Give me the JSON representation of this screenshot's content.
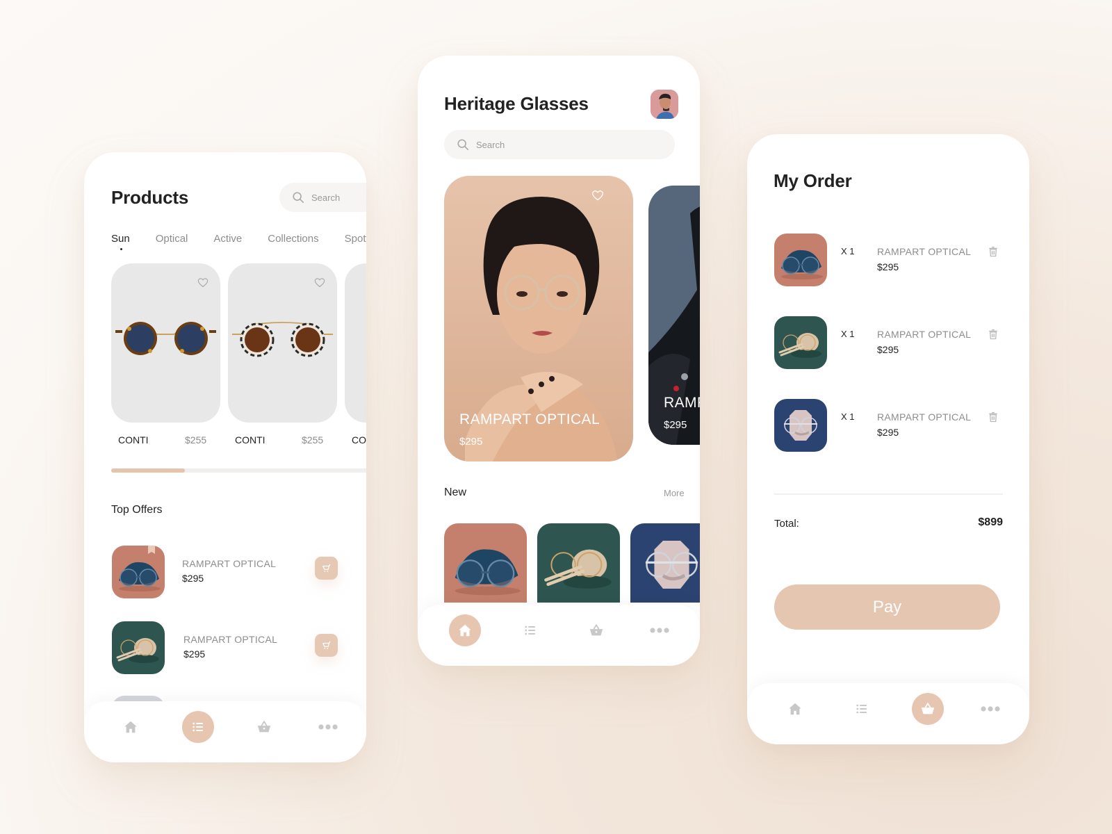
{
  "colors": {
    "accent": "#e4c6b1",
    "text_primary": "#222222",
    "text_secondary": "#8d8d8d",
    "icon_inactive": "#c8c8c8"
  },
  "products_screen": {
    "title": "Products",
    "search_placeholder": "Search",
    "tabs": [
      {
        "label": "Sun",
        "active": true
      },
      {
        "label": "Optical",
        "active": false
      },
      {
        "label": "Active",
        "active": false
      },
      {
        "label": "Collections",
        "active": false
      },
      {
        "label": "Spotti",
        "active": false
      }
    ],
    "products": [
      {
        "name": "CONTI",
        "price": "$255",
        "style": "tortoise-blue"
      },
      {
        "name": "CONTI",
        "price": "$255",
        "style": "marble-brown"
      },
      {
        "name": "CO",
        "price": "",
        "style": "partial"
      }
    ],
    "scroll_progress": 0.28,
    "top_offers_title": "Top Offers",
    "offers": [
      {
        "name": "RAMPART OPTICAL",
        "price": "$295",
        "thumb": "terracotta"
      },
      {
        "name": "RAMPART OPTICAL",
        "price": "$295",
        "thumb": "green"
      }
    ],
    "nav": [
      {
        "icon": "home-icon",
        "active": false
      },
      {
        "icon": "list-icon",
        "active": true
      },
      {
        "icon": "basket-icon",
        "active": false
      },
      {
        "icon": "more-icon",
        "active": false
      }
    ]
  },
  "home_screen": {
    "title": "Heritage Glasses",
    "search_placeholder": "Search",
    "featured": [
      {
        "name": "RAMPART OPTICAL",
        "price": "$295"
      },
      {
        "name": "RAMPART OPTICAL",
        "price": "$295"
      }
    ],
    "new_section_title": "New",
    "more_label": "More",
    "new_items": [
      "terracotta",
      "green",
      "navy"
    ],
    "nav": [
      {
        "icon": "home-icon",
        "active": true
      },
      {
        "icon": "list-icon",
        "active": false
      },
      {
        "icon": "basket-icon",
        "active": false
      },
      {
        "icon": "more-icon",
        "active": false
      }
    ]
  },
  "order_screen": {
    "title": "My Order",
    "items": [
      {
        "qty": "X 1",
        "name": "RAMPART OPTICAL",
        "price": "$295",
        "thumb": "terracotta"
      },
      {
        "qty": "X 1",
        "name": "RAMPART OPTICAL",
        "price": "$295",
        "thumb": "green"
      },
      {
        "qty": "X 1",
        "name": "RAMPART OPTICAL",
        "price": "$295",
        "thumb": "navy"
      }
    ],
    "total_label": "Total:",
    "total_value": "$899",
    "pay_label": "Pay",
    "nav": [
      {
        "icon": "home-icon",
        "active": false
      },
      {
        "icon": "list-icon",
        "active": false
      },
      {
        "icon": "basket-icon",
        "active": true
      },
      {
        "icon": "more-icon",
        "active": false
      }
    ]
  }
}
